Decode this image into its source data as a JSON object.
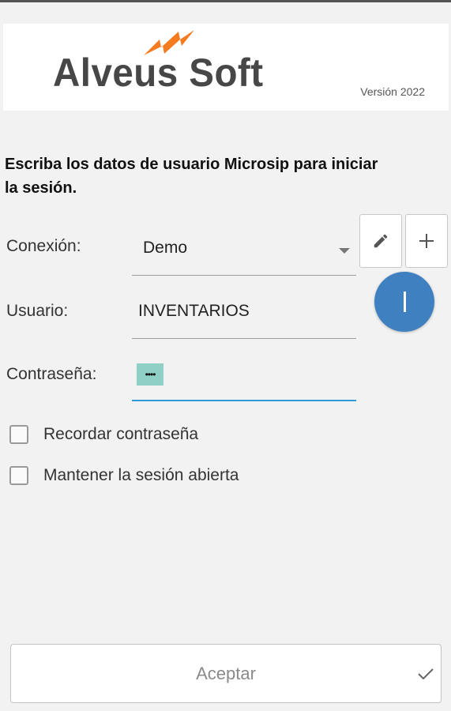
{
  "header": {
    "logo_text": "Alveus Soft",
    "version": "Versión 2022",
    "brand_color": "#f47b20"
  },
  "instruction": "Escriba los datos de usuario Microsip para iniciar la sesión.",
  "form": {
    "connection_label": "Conexión:",
    "connection_value": "Demo",
    "user_label": "Usuario:",
    "user_value": "INVENTARIOS",
    "password_label": "Contraseña:",
    "password_mask": "••••",
    "focus_color": "#2e9ad8"
  },
  "buttons": {
    "edit_icon": "pencil-icon",
    "add_icon": "plus-icon",
    "fab_icon": "i-icon",
    "fab_color": "#3e80c0"
  },
  "options": {
    "remember_password": {
      "label": "Recordar contraseña",
      "checked": false
    },
    "keep_session": {
      "label": "Mantener la sesión abierta",
      "checked": false
    }
  },
  "footer": {
    "accept_label": "Aceptar",
    "accept_icon": "check-icon"
  }
}
